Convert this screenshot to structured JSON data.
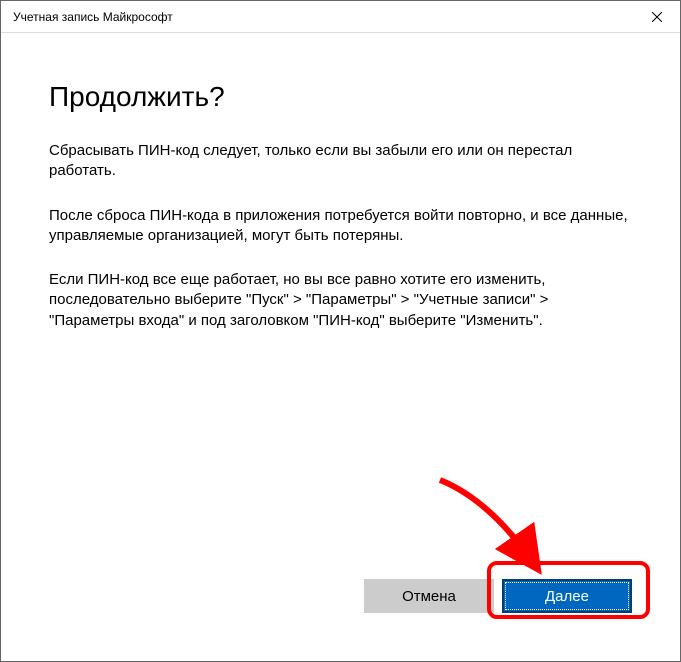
{
  "titlebar": {
    "title": "Учетная запись Майкрософт"
  },
  "content": {
    "heading": "Продолжить?",
    "paragraph1": "Сбрасывать ПИН-код следует, только если вы забыли его или он перестал работать.",
    "paragraph2": "После сброса ПИН-кода в приложения потребуется войти повторно, и все данные, управляемые организацией, могут быть потеряны.",
    "paragraph3": "Если ПИН-код все еще работает, но вы все равно хотите его изменить, последовательно выберите \"Пуск\" > \"Параметры\" > \"Учетные записи\" > \"Параметры входа\" и под заголовком \"ПИН-код\" выберите \"Изменить\"."
  },
  "buttons": {
    "cancel": "Отмена",
    "next": "Далее"
  }
}
